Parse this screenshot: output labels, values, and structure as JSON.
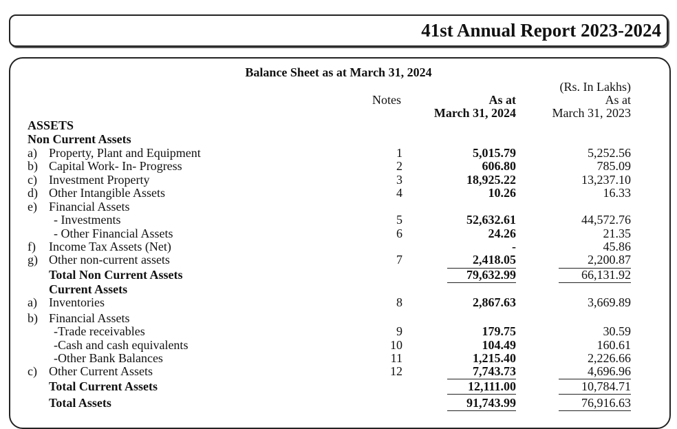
{
  "header": {
    "title": "41st Annual Report 2023-2024"
  },
  "sheet": {
    "title": "Balance Sheet as at March 31, 2024",
    "currency_note": "(Rs. In Lakhs)",
    "col_notes": "Notes",
    "col_current": [
      "As at",
      "March 31, 2024"
    ],
    "col_previous": [
      "As at",
      "March 31, 2023"
    ]
  },
  "rows": [
    {
      "prefix": "",
      "label": "ASSETS",
      "note": "",
      "cy": "",
      "py": "",
      "bold": true,
      "indent": 0
    },
    {
      "prefix": "",
      "label": "Non Current Assets",
      "note": "",
      "cy": "",
      "py": "",
      "bold": true,
      "indent": 0
    },
    {
      "prefix": "a)",
      "label": "Property, Plant and Equipment",
      "note": "1",
      "cy": "5,015.79",
      "py": "5,252.56",
      "bold": false,
      "indent": 1
    },
    {
      "prefix": "b)",
      "label": "Capital Work- In- Progress",
      "note": "2",
      "cy": "606.80",
      "py": "785.09",
      "bold": false,
      "indent": 1
    },
    {
      "prefix": "c)",
      "label": "Investment Property",
      "note": "3",
      "cy": "18,925.22",
      "py": "13,237.10",
      "bold": false,
      "indent": 1
    },
    {
      "prefix": "d)",
      "label": "Other Intangible Assets",
      "note": "4",
      "cy": "10.26",
      "py": "16.33",
      "bold": false,
      "indent": 1
    },
    {
      "prefix": "e)",
      "label": "Financial Assets",
      "note": "",
      "cy": "",
      "py": "",
      "bold": false,
      "indent": 1
    },
    {
      "prefix": "",
      "label": "- Investments",
      "note": "5",
      "cy": "52,632.61",
      "py": "44,572.76",
      "bold": false,
      "indent": 2
    },
    {
      "prefix": "",
      "label": "- Other Financial Assets",
      "note": "6",
      "cy": "24.26",
      "py": "21.35",
      "bold": false,
      "indent": 2
    },
    {
      "prefix": "f)",
      "label": "Income Tax Assets (Net)",
      "note": "",
      "cy": "-",
      "py": "45.86",
      "bold": false,
      "indent": 1
    },
    {
      "prefix": "g)",
      "label": "Other non-current assets",
      "note": "7",
      "cy": "2,418.05",
      "py": "2,200.87",
      "bold": false,
      "indent": 1
    },
    {
      "prefix": "",
      "label": "Total Non Current Assets",
      "note": "",
      "cy": "79,632.99",
      "py": "66,131.92",
      "bold": true,
      "indent": 1
    },
    {
      "prefix": "",
      "label": "Current Assets",
      "note": "",
      "cy": "",
      "py": "",
      "bold": true,
      "indent": 1
    },
    {
      "prefix": "a)",
      "label": "Inventories",
      "note": "8",
      "cy": "2,867.63",
      "py": "3,669.89",
      "bold": false,
      "indent": 1
    },
    {
      "prefix": "b)",
      "label": "Financial Assets",
      "note": "",
      "cy": "",
      "py": "",
      "bold": false,
      "indent": 1
    },
    {
      "prefix": "",
      "label": "-Trade receivables",
      "note": "9",
      "cy": "179.75",
      "py": "30.59",
      "bold": false,
      "indent": 2
    },
    {
      "prefix": "",
      "label": "-Cash and cash equivalents",
      "note": "10",
      "cy": "104.49",
      "py": "160.61",
      "bold": false,
      "indent": 2
    },
    {
      "prefix": "",
      "label": "-Other Bank Balances",
      "note": "11",
      "cy": "1,215.40",
      "py": "2,226.66",
      "bold": false,
      "indent": 2
    },
    {
      "prefix": "c)",
      "label": "Other Current Assets",
      "note": "12",
      "cy": "7,743.73",
      "py": "4,696.96",
      "bold": false,
      "indent": 1
    },
    {
      "prefix": "",
      "label": "Total Current Assets",
      "note": "",
      "cy": "12,111.00",
      "py": "10,784.71",
      "bold": true,
      "indent": 1
    },
    {
      "prefix": "",
      "label": "Total Assets",
      "note": "",
      "cy": "91,743.99",
      "py": "76,916.63",
      "bold": true,
      "indent": 1
    }
  ]
}
